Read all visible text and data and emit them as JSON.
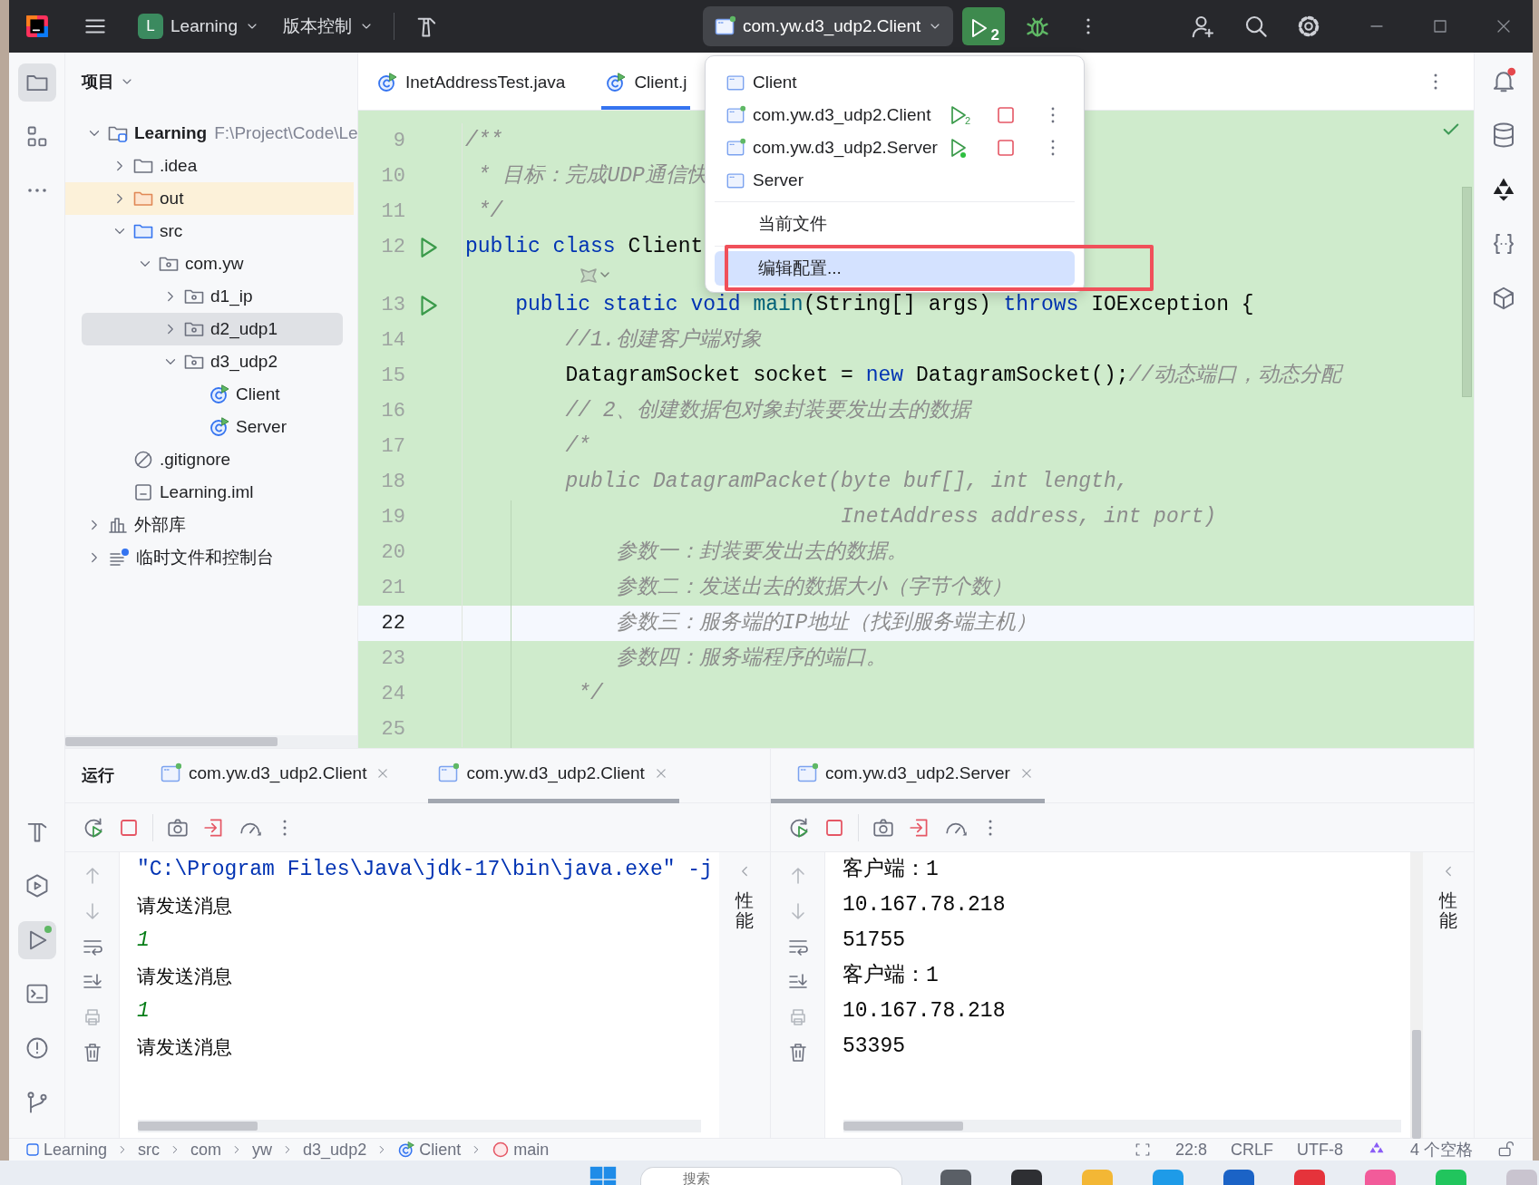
{
  "title_bar": {
    "project_badge": "L",
    "project": "Learning",
    "vcs": "版本控制",
    "run_config": "com.yw.d3_udp2.Client",
    "run_count": "2"
  },
  "left_toolbar": {
    "top": [
      {
        "kind": "project",
        "selected": true,
        "running": false
      },
      {
        "kind": "structure",
        "selected": false,
        "running": false
      },
      {
        "kind": "more",
        "selected": false,
        "running": false
      }
    ],
    "bottom": [
      {
        "kind": "build",
        "selected": false,
        "running": false
      },
      {
        "kind": "services",
        "selected": false,
        "running": false
      },
      {
        "kind": "run",
        "selected": true,
        "running": true
      },
      {
        "kind": "terminal",
        "selected": false,
        "running": false
      },
      {
        "kind": "problems",
        "selected": false,
        "running": false
      },
      {
        "kind": "git",
        "selected": false,
        "running": false
      }
    ]
  },
  "right_toolbar": [
    {
      "kind": "notifications",
      "alert": true
    },
    {
      "kind": "database",
      "alert": false
    },
    {
      "kind": "ai",
      "alert": false
    },
    {
      "kind": "json",
      "alert": false
    },
    {
      "kind": "plugin",
      "alert": false
    }
  ],
  "project_panel": {
    "title": "项目",
    "tree": [
      {
        "label": "Learning",
        "kind": "project",
        "path": "F:\\Project\\Code\\Le",
        "expanded": true,
        "selected": false,
        "children": [
          {
            "label": ".idea",
            "kind": "folder",
            "expanded": false,
            "selected": false
          },
          {
            "label": "out",
            "kind": "excluded",
            "expanded": false,
            "selected": false
          },
          {
            "label": "src",
            "kind": "source",
            "expanded": true,
            "selected": false,
            "children": [
              {
                "label": "com.yw",
                "kind": "package",
                "expanded": true,
                "selected": false,
                "children": [
                  {
                    "label": "d1_ip",
                    "kind": "package",
                    "expanded": false,
                    "selected": false
                  },
                  {
                    "label": "d2_udp1",
                    "kind": "package",
                    "expanded": false,
                    "selected": true
                  },
                  {
                    "label": "d3_udp2",
                    "kind": "package",
                    "expanded": true,
                    "selected": false,
                    "children": [
                      {
                        "label": "Client",
                        "kind": "class",
                        "selected": false
                      },
                      {
                        "label": "Server",
                        "kind": "class",
                        "selected": false
                      }
                    ]
                  }
                ]
              }
            ]
          },
          {
            "label": ".gitignore",
            "kind": "ignore",
            "selected": false
          },
          {
            "label": "Learning.iml",
            "kind": "module-file",
            "selected": false
          }
        ]
      },
      {
        "label": "外部库",
        "kind": "library",
        "expanded": false,
        "selected": false
      },
      {
        "label": "临时文件和控制台",
        "kind": "scratch",
        "expanded": false,
        "selected": false
      }
    ]
  },
  "editor": {
    "tabs": [
      {
        "label": "InetAddressTest.java",
        "selected": false
      },
      {
        "label": "Client.j",
        "selected": true
      }
    ],
    "lines": [
      {
        "kind": "code",
        "number": "9",
        "run": false,
        "current": false,
        "segments": [
          {
            "kind": "comment",
            "text": "/**"
          }
        ]
      },
      {
        "kind": "code",
        "number": "10",
        "run": false,
        "current": false,
        "segments": [
          {
            "kind": "comment",
            "text": " * 目标：完成UDP通信快"
          }
        ]
      },
      {
        "kind": "code",
        "number": "11",
        "run": false,
        "current": false,
        "segments": [
          {
            "kind": "comment",
            "text": " */"
          }
        ]
      },
      {
        "kind": "code",
        "number": "12",
        "run": true,
        "current": false,
        "segments": [
          {
            "kind": "keyword",
            "text": "public class "
          },
          {
            "kind": "plain",
            "text": "Client"
          }
        ]
      },
      {
        "kind": "hint"
      },
      {
        "kind": "code",
        "number": "13",
        "run": true,
        "current": false,
        "segments": [
          {
            "kind": "keyword",
            "text": "    public static void "
          },
          {
            "kind": "method",
            "text": "main"
          },
          {
            "kind": "plain",
            "text": "(String[] args) "
          },
          {
            "kind": "keyword",
            "text": "throws "
          },
          {
            "kind": "plain",
            "text": "IOException {"
          }
        ]
      },
      {
        "kind": "code",
        "number": "14",
        "run": false,
        "current": false,
        "segments": [
          {
            "kind": "comment",
            "text": "        //1.创建客户端对象"
          }
        ]
      },
      {
        "kind": "code",
        "number": "15",
        "run": false,
        "current": false,
        "segments": [
          {
            "kind": "plain",
            "text": "        DatagramSocket socket = "
          },
          {
            "kind": "keyword",
            "text": "new "
          },
          {
            "kind": "plain",
            "text": "DatagramSocket();"
          },
          {
            "kind": "comment",
            "text": "//动态端口，动态分配"
          }
        ]
      },
      {
        "kind": "code",
        "number": "16",
        "run": false,
        "current": false,
        "segments": [
          {
            "kind": "comment",
            "text": "        // 2、创建数据包对象封装要发出去的数据"
          }
        ]
      },
      {
        "kind": "code",
        "number": "17",
        "run": false,
        "current": false,
        "segments": [
          {
            "kind": "comment",
            "text": "        /*"
          }
        ]
      },
      {
        "kind": "code",
        "number": "18",
        "run": false,
        "current": false,
        "segments": [
          {
            "kind": "comment",
            "text": "        public DatagramPacket(byte buf[], int length,"
          }
        ]
      },
      {
        "kind": "code",
        "number": "19",
        "run": false,
        "current": false,
        "segments": [
          {
            "kind": "comment",
            "text": "                              InetAddress address, int port)"
          }
        ]
      },
      {
        "kind": "code",
        "number": "20",
        "run": false,
        "current": false,
        "segments": [
          {
            "kind": "comment",
            "text": "            参数一：封装要发出去的数据。"
          }
        ]
      },
      {
        "kind": "code",
        "number": "21",
        "run": false,
        "current": false,
        "segments": [
          {
            "kind": "comment",
            "text": "            参数二：发送出去的数据大小（字节个数）"
          }
        ]
      },
      {
        "kind": "code",
        "number": "22",
        "run": false,
        "current": true,
        "segments": [
          {
            "kind": "comment",
            "text": "            参数三：服务端的IP地址（找到服务端主机）"
          }
        ]
      },
      {
        "kind": "code",
        "number": "23",
        "run": false,
        "current": false,
        "segments": [
          {
            "kind": "comment",
            "text": "            参数四：服务端程序的端口。"
          }
        ]
      },
      {
        "kind": "code",
        "number": "24",
        "run": false,
        "current": false,
        "segments": [
          {
            "kind": "comment",
            "text": "         */"
          }
        ]
      },
      {
        "kind": "code",
        "number": "25",
        "run": false,
        "current": false
      }
    ]
  },
  "run_menu": {
    "items": [
      {
        "kind": "config",
        "label": "Client",
        "running": false
      },
      {
        "kind": "config",
        "label": "com.yw.d3_udp2.Client",
        "running": true,
        "instances": "2"
      },
      {
        "kind": "config",
        "label": "com.yw.d3_udp2.Server",
        "running": true
      },
      {
        "kind": "config",
        "label": "Server",
        "running": false
      },
      {
        "kind": "separator"
      },
      {
        "kind": "action",
        "label": "当前文件",
        "selected": false
      },
      {
        "kind": "separator"
      },
      {
        "kind": "action",
        "label": "编辑配置...",
        "selected": true
      }
    ]
  },
  "run_panel": {
    "title": "运行",
    "panes": [
      {
        "tabs": [
          {
            "label": "com.yw.d3_udp2.Client",
            "selected": false
          },
          {
            "label": "com.yw.d3_udp2.Client",
            "selected": true
          }
        ],
        "side_label": "性能",
        "console": [
          {
            "kind": "command",
            "text": "\"C:\\Program Files\\Java\\jdk-17\\bin\\java.exe\" -j"
          },
          {
            "kind": "output",
            "text": "请发送消息"
          },
          {
            "kind": "input",
            "text": "1"
          },
          {
            "kind": "output",
            "text": "请发送消息"
          },
          {
            "kind": "input",
            "text": "1"
          },
          {
            "kind": "output",
            "text": "请发送消息"
          }
        ]
      },
      {
        "tabs": [
          {
            "label": "com.yw.d3_udp2.Server",
            "selected": true
          }
        ],
        "side_label": "性能",
        "console": [
          {
            "kind": "output",
            "text": "客户端：1"
          },
          {
            "kind": "output",
            "text": "10.167.78.218"
          },
          {
            "kind": "output",
            "text": "51755"
          },
          {
            "kind": "output",
            "text": "客户端：1"
          },
          {
            "kind": "output",
            "text": "10.167.78.218"
          },
          {
            "kind": "output",
            "text": "53395"
          }
        ]
      }
    ]
  },
  "status_bar": {
    "breadcrumbs": [
      {
        "kind": "module",
        "label": "Learning"
      },
      {
        "kind": "folder",
        "label": "src"
      },
      {
        "kind": "folder",
        "label": "com"
      },
      {
        "kind": "folder",
        "label": "yw"
      },
      {
        "kind": "folder",
        "label": "d3_udp2"
      },
      {
        "kind": "class",
        "label": "Client"
      },
      {
        "kind": "method",
        "label": "main"
      }
    ],
    "position": "22:8",
    "line_separator": "CRLF",
    "encoding": "UTF-8",
    "indent": "4 个空格"
  },
  "taskbar": {
    "search": {
      "placeholder": "搜索"
    }
  }
}
